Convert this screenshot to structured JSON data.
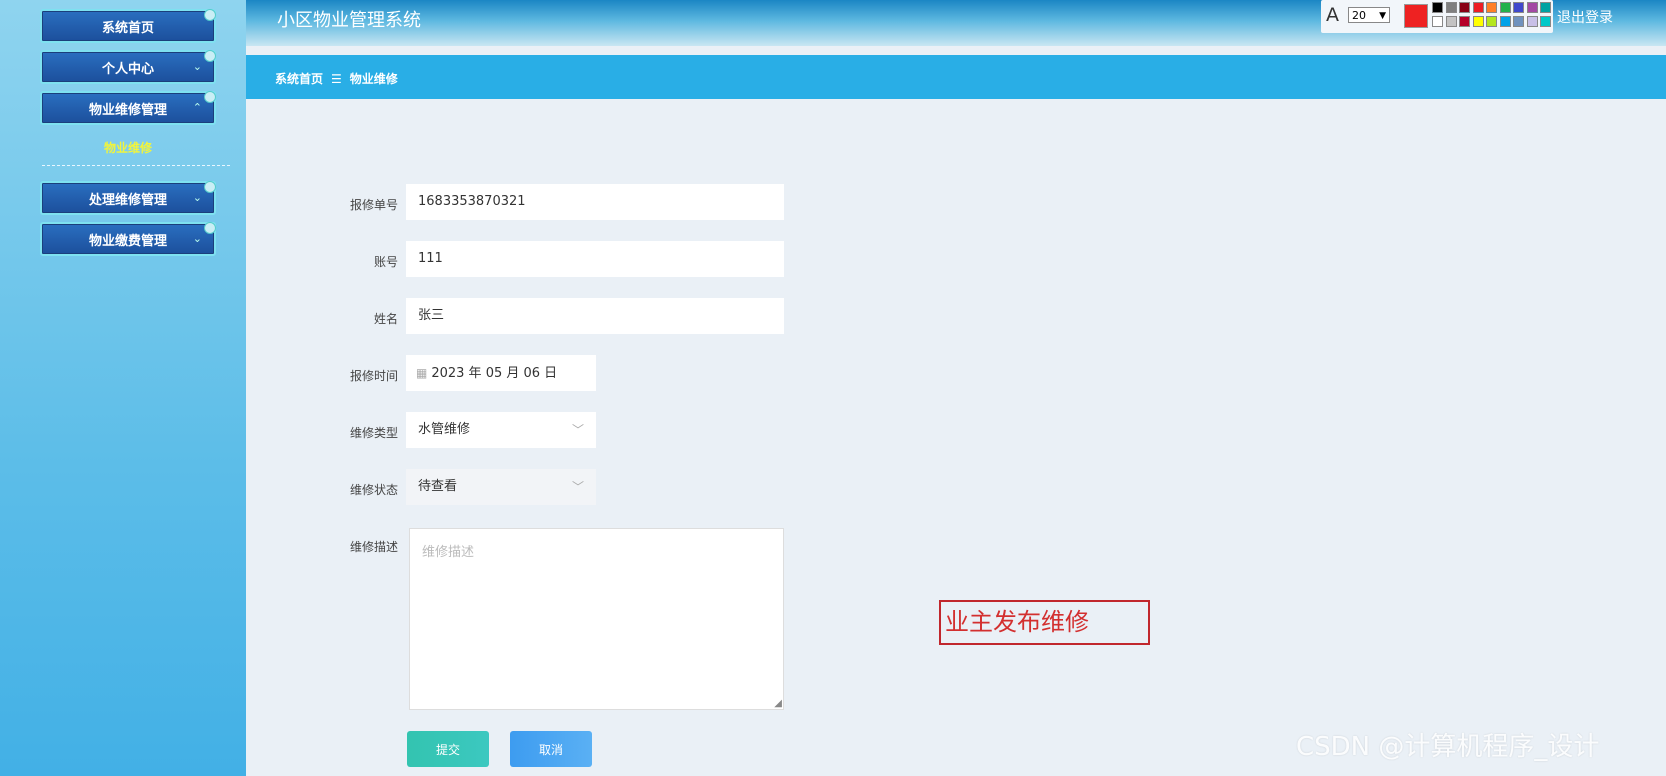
{
  "app": {
    "title": "小区物业管理系统",
    "logout": "退出登录"
  },
  "toolbar": {
    "font_glyph": "A",
    "font_size": "20",
    "current_color": "#ee2222",
    "palette": [
      "#000000",
      "#7f7f7f",
      "#880015",
      "#ed1c24",
      "#ff7f27",
      "#22b14c",
      "#3f48cc",
      "#a349a4",
      "#00a2a2",
      "#ffffff",
      "#c3c3c3",
      "#b5002a",
      "#ffff00",
      "#b5e61d",
      "#00a2e8",
      "#7092be",
      "#c8bfe7",
      "#00c8c8"
    ]
  },
  "sidebar": {
    "items": [
      {
        "label": "系统首页"
      },
      {
        "label": "个人中心"
      },
      {
        "label": "物业维修管理"
      },
      {
        "label": "处理维修管理"
      },
      {
        "label": "物业缴费管理"
      }
    ],
    "sub_item": "物业维修"
  },
  "breadcrumb": {
    "home": "系统首页",
    "sep": "☰",
    "current": "物业维修"
  },
  "form": {
    "order_no_label": "报修单号",
    "order_no": "1683353870321",
    "account_label": "账号",
    "account": "111",
    "name_label": "姓名",
    "name": "张三",
    "time_label": "报修时间",
    "time": "2023 年 05 月 06 日",
    "type_label": "维修类型",
    "type": "水管维修",
    "status_label": "维修状态",
    "status": "待查看",
    "desc_label": "维修描述",
    "desc_placeholder": "维修描述",
    "submit": "提交",
    "cancel": "取消"
  },
  "annotation": "业主发布维修",
  "watermark": "CSDN @计算机程序_设计"
}
